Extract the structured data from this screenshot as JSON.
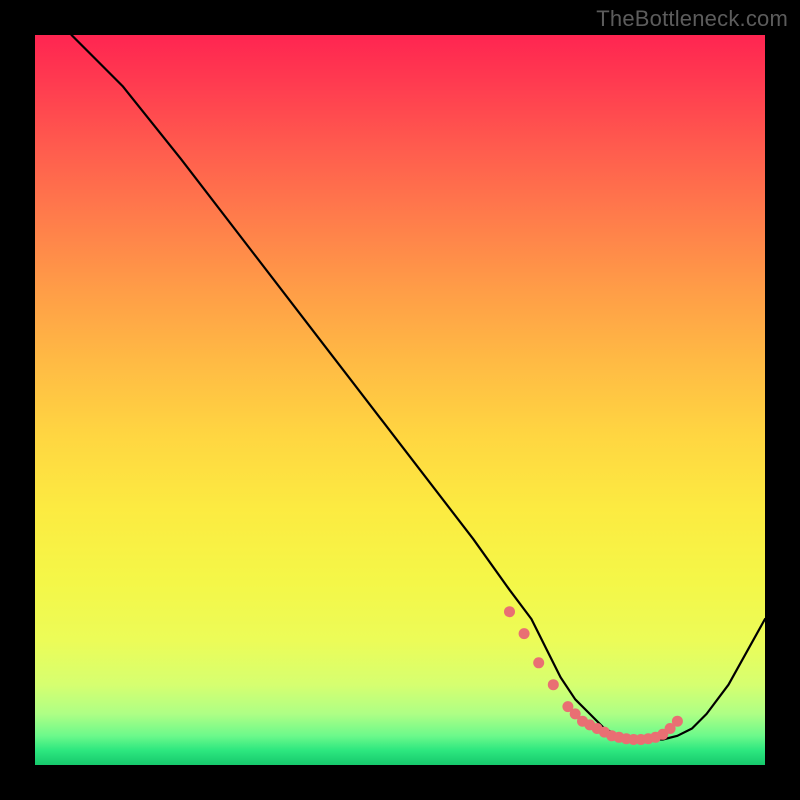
{
  "watermark": "TheBottleneck.com",
  "chart_data": {
    "type": "line",
    "title": "",
    "xlabel": "",
    "ylabel": "",
    "xlim": [
      0,
      100
    ],
    "ylim": [
      0,
      100
    ],
    "series": [
      {
        "name": "bottleneck-curve",
        "x": [
          5,
          8,
          12,
          20,
          30,
          40,
          50,
          60,
          65,
          68,
          70,
          72,
          74,
          76,
          78,
          80,
          82,
          84,
          85,
          86,
          88,
          90,
          92,
          95,
          100
        ],
        "values": [
          100,
          97,
          93,
          83,
          70,
          57,
          44,
          31,
          24,
          20,
          16,
          12,
          9,
          7,
          5,
          4,
          3.5,
          3.5,
          3.5,
          3.5,
          4,
          5,
          7,
          11,
          20
        ]
      }
    ],
    "markers": {
      "name": "highlight-dots",
      "color": "#e96f73",
      "x": [
        65,
        67,
        69,
        71,
        73,
        74,
        75,
        76,
        77,
        78,
        79,
        80,
        81,
        82,
        83,
        84,
        85,
        86,
        87,
        88
      ],
      "values": [
        21,
        18,
        14,
        11,
        8,
        7,
        6,
        5.5,
        5,
        4.5,
        4,
        3.8,
        3.6,
        3.5,
        3.5,
        3.6,
        3.8,
        4.2,
        5,
        6
      ]
    },
    "colors": {
      "curve": "#000000",
      "marker": "#e96f73",
      "gradient_top": "#ff2551",
      "gradient_bottom": "#16c96c"
    }
  }
}
